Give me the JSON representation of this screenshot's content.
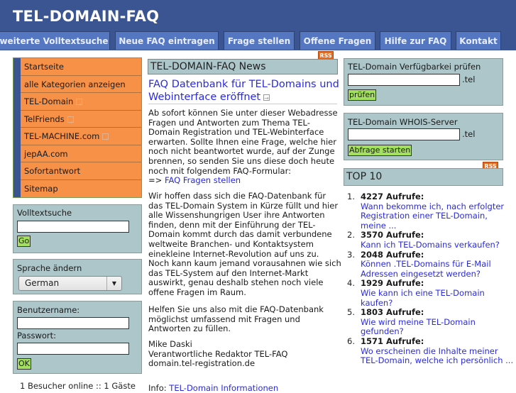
{
  "header": {
    "title": "TEL-DOMAIN-FAQ",
    "tabs": [
      {
        "label": "weiterte Volltextsuche"
      },
      {
        "label": "Neue FAQ eintragen"
      },
      {
        "label": "Frage stellen"
      },
      {
        "label": "Offene Fragen"
      },
      {
        "label": "Hilfe zur FAQ"
      },
      {
        "label": "Kontakt"
      }
    ]
  },
  "rss_label": "RSS",
  "nav": {
    "items": [
      {
        "label": "Startseite",
        "expandable": false
      },
      {
        "label": "alle Kategorien anzeigen",
        "expandable": false
      },
      {
        "label": "TEL-Domain",
        "expandable": true
      },
      {
        "label": "TelFriends",
        "expandable": true
      },
      {
        "label": "TEL-MACHINE.com",
        "expandable": true
      },
      {
        "label": "jepAA.com",
        "expandable": false
      },
      {
        "label": "Sofortantwort",
        "expandable": false
      },
      {
        "label": "Sitemap",
        "expandable": false
      }
    ]
  },
  "search": {
    "label": "Volltextsuche",
    "value": "",
    "button": "Go"
  },
  "language": {
    "label": "Sprache ändern",
    "selected": "German"
  },
  "login": {
    "username_label": "Benutzername:",
    "password_label": "Passwort:",
    "username_value": "",
    "password_value": "",
    "button": "OK"
  },
  "online_text": "1 Besucher online :: 1 Gäste",
  "news": {
    "heading": "TEL-DOMAIN-FAQ News",
    "title": "FAQ Datenbank für TEL-Domains und Webinterface eröffnet",
    "para1": "Ab sofort können Sie unter dieser Webadresse Fragen und Antworten zum Thema TEL-Domain Registration und TEL-Webinterface erwarten. Sollte Ihnen eine Frage, welche hier noch nicht beantwortet wurde, auf der Zunge brennen, so senden Sie uns diese doch heute noch mit folgendem FAQ-Formular:",
    "link_prefix": "=> ",
    "link_label": "FAQ Fragen stellen",
    "para2": "Wir hoffen dass sich die FAQ-Datenbank für das TEL-Domain System in Kürze füllt und hier alle Wissenshungrigen User ihre Antworten finden, denn mit der Einführung der TEL-Domain kommt durch das damit verbundene weltweite Branchen- und Kontaktsystem einekleine Internet-Revolution auf uns zu. Noch kann kaum jemand vorausahnen wie sich das TEL-System auf den Internet-Markt auswirkt, genau deshalb stehen noch viele offene Fragen im Raum.",
    "para3": "Helfen Sie uns also mit die FAQ-Datenbank möglichst umfassend mit Fragen und Antworten zu füllen.",
    "sig_name": "Mike Daski",
    "sig_role": "Verantwortliche Redaktor TEL-FAQ",
    "sig_domain": "domain.tel-registration.de"
  },
  "footer_info": {
    "prefix": "Info: ",
    "link": "TEL-Domain Informationen"
  },
  "availability": {
    "label": "TEL-Domain Verfügbarkei prüfen",
    "value": "",
    "suffix": ".tel",
    "button": "prüfen"
  },
  "whois": {
    "label": "TEL-Domain WHOIS-Server",
    "value": "",
    "suffix": ".tel",
    "button": "Abfrage starten"
  },
  "top10": {
    "heading": "TOP 10",
    "items": [
      {
        "num": "1.",
        "count": "4227 Aufrufe:",
        "question": "Wann bekomme ich, nach erfolgter Registration einer TEL-Domain, meine ..."
      },
      {
        "num": "2.",
        "count": "3570 Aufrufe:",
        "question": "Kann ich TEL-Domains verkaufen?"
      },
      {
        "num": "3.",
        "count": "2048 Aufrufe:",
        "question": "Können .TEL-Domains für E-Mail Adressen eingesetzt werden?"
      },
      {
        "num": "4.",
        "count": "1929 Aufrufe:",
        "question": "Wie kann ich eine TEL-Domain kaufen?"
      },
      {
        "num": "5.",
        "count": "1803 Aufrufe:",
        "question": "Wie wird meine TEL-Domain gefunden?"
      },
      {
        "num": "6.",
        "count": "1571 Aufrufe:",
        "question": "Wo erscheinen die Inhalte meiner TEL-Domain, welche ich persönlich ..."
      }
    ]
  }
}
